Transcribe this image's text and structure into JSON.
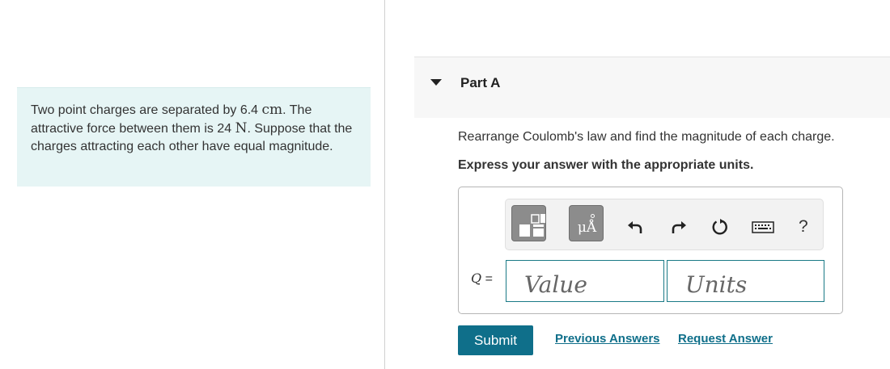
{
  "problem": {
    "part1": "Two point charges are separated by 6.4 ",
    "unit_cm": "cm",
    "part2": ". The attractive force between them is 24 ",
    "unit_n": "N",
    "part3": ". Suppose that the charges attracting each other have equal magnitude."
  },
  "part": {
    "title": "Part A",
    "prompt": "Rearrange Coulomb's law and find the magnitude of each charge.",
    "instruction": "Express your answer with the appropriate units."
  },
  "toolbar": {
    "units_symbol": "μÅ",
    "help_label": "?",
    "icons": [
      "templates-icon",
      "units-icon",
      "undo-icon",
      "redo-icon",
      "reset-icon",
      "keyboard-icon",
      "help-icon"
    ]
  },
  "answer": {
    "variable": "Q",
    "equals": " =",
    "value_placeholder": "Value",
    "units_placeholder": "Units"
  },
  "actions": {
    "submit_label": "Submit",
    "previous_answers_label": "Previous Answers",
    "request_answer_label": "Request Answer"
  },
  "colors": {
    "problem_bg": "#e6f5f5",
    "accent": "#0f6f8a",
    "field_border": "#1a7a86"
  }
}
